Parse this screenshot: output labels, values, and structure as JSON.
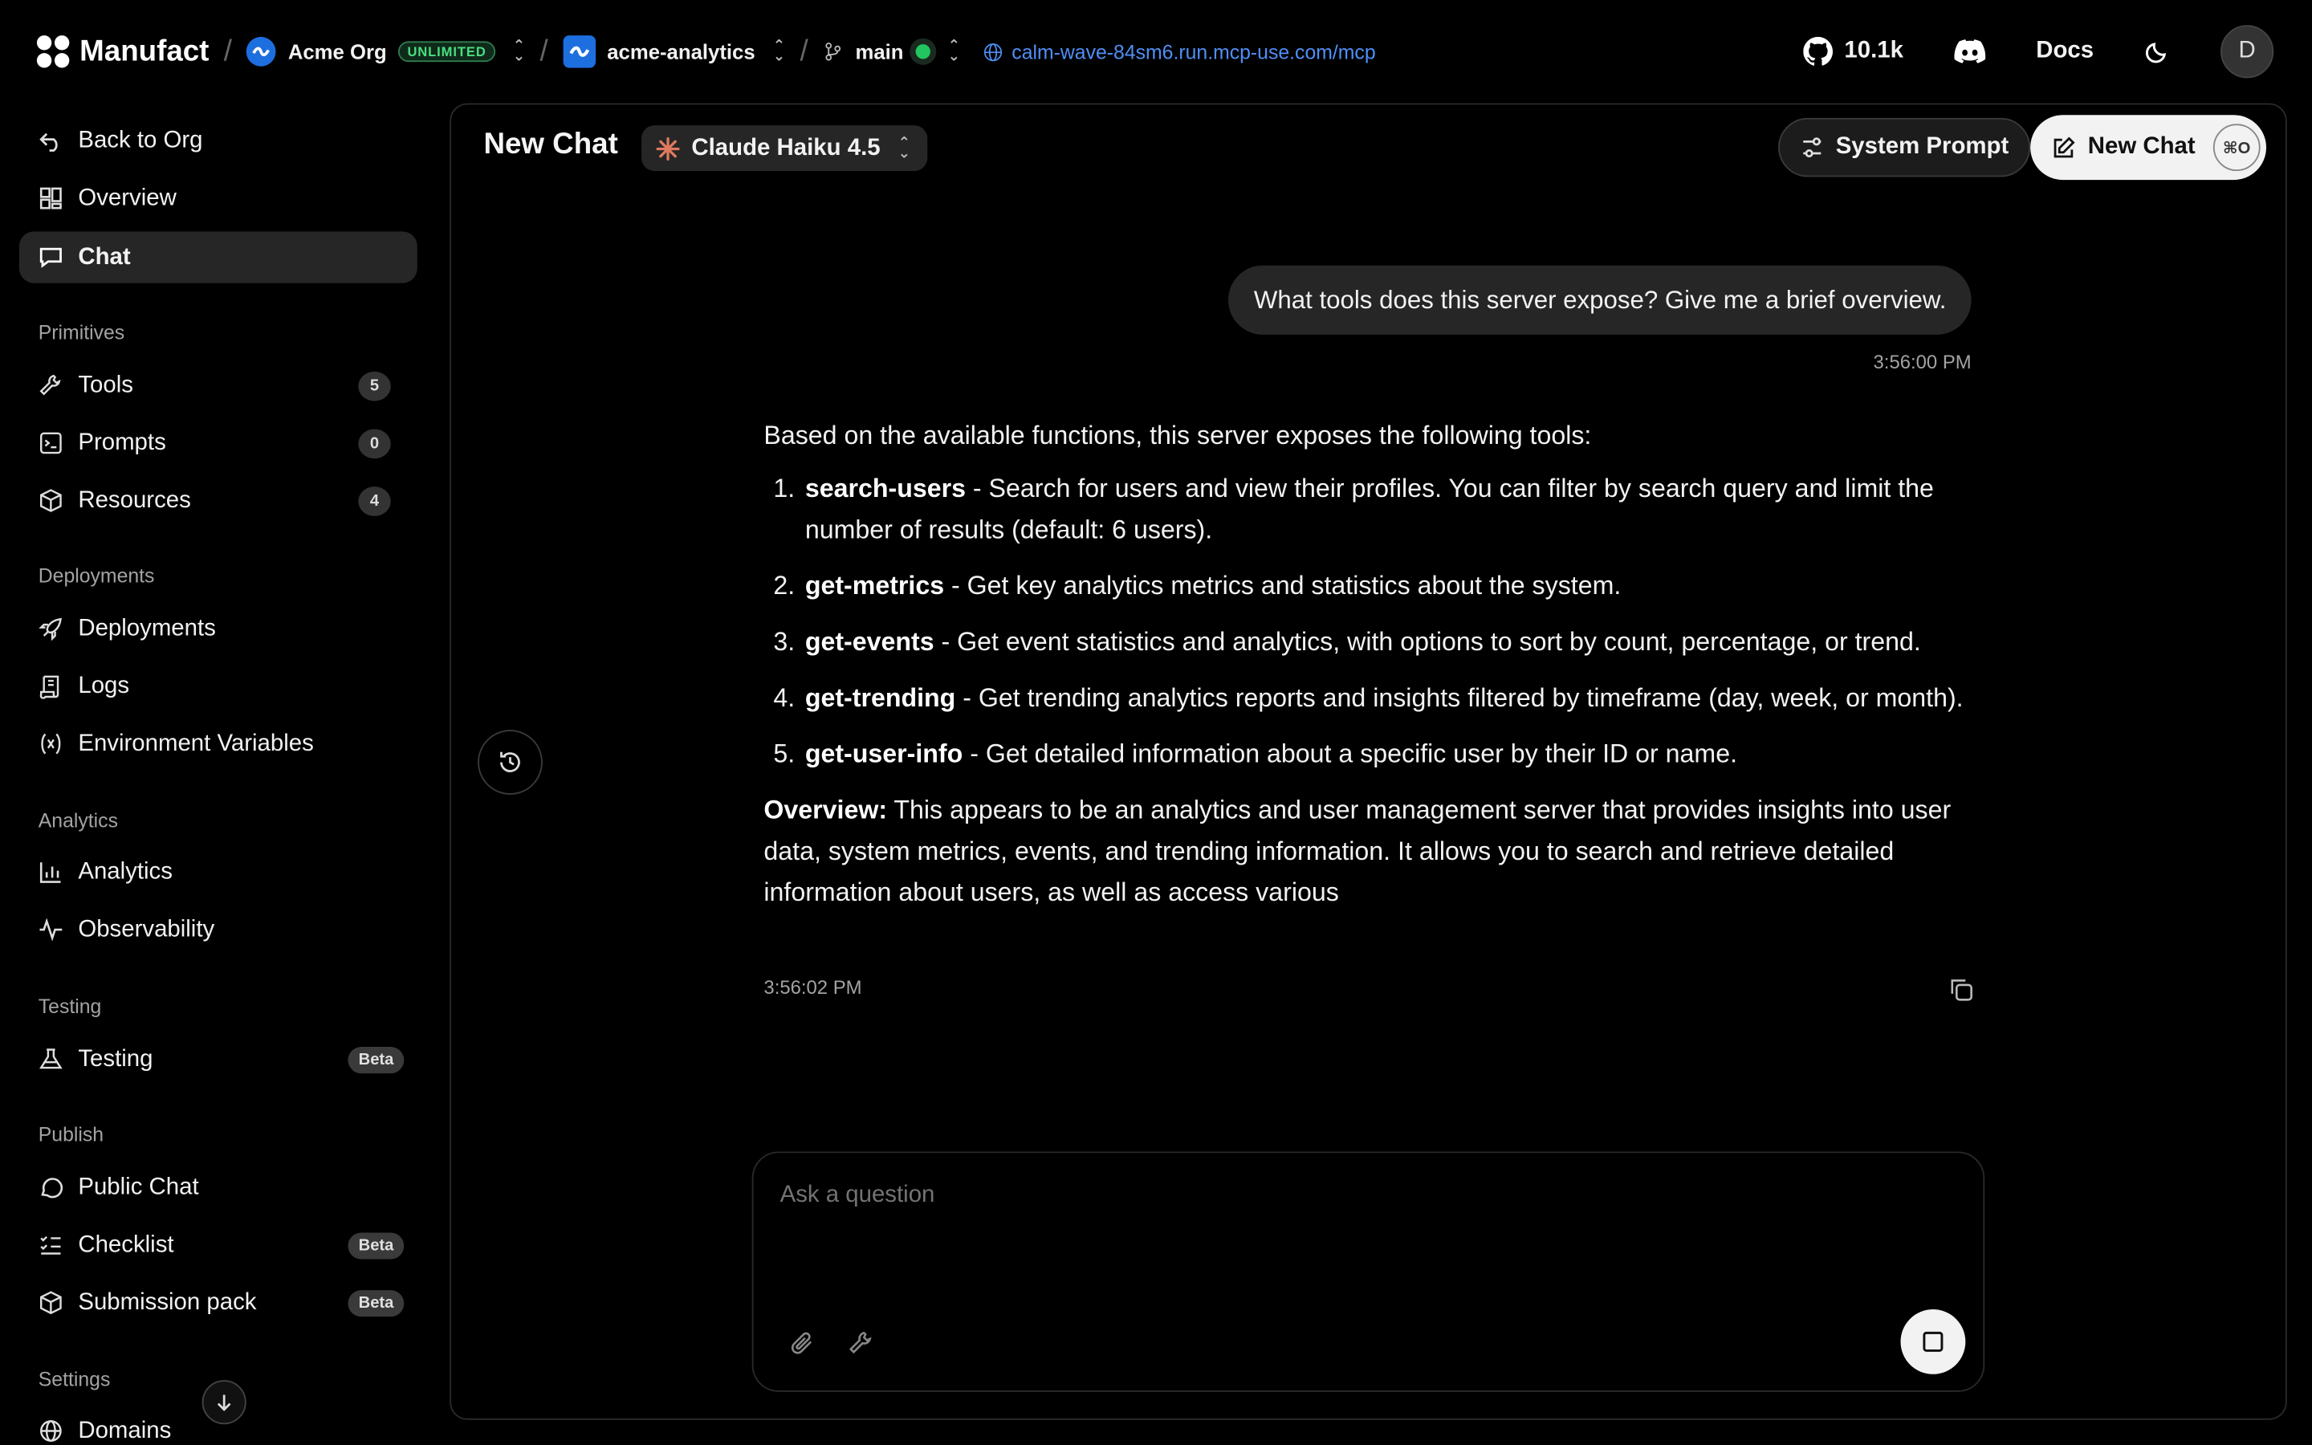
{
  "topbar": {
    "brand": "Manufact",
    "org_name": "Acme Org",
    "org_plan": "UNLIMITED",
    "project": "acme-analytics",
    "branch": "main",
    "url": "calm-wave-84sm6.run.mcp-use.com/mcp",
    "github_stars": "10.1k",
    "docs_label": "Docs",
    "avatar_initial": "D"
  },
  "sidebar": {
    "back": "Back to Org",
    "overview": "Overview",
    "chat": "Chat",
    "sections": {
      "primitives": "Primitives",
      "deployments": "Deployments",
      "analytics": "Analytics",
      "testing": "Testing",
      "publish": "Publish",
      "settings": "Settings"
    },
    "items": {
      "tools": "Tools",
      "tools_count": "5",
      "prompts": "Prompts",
      "prompts_count": "0",
      "resources": "Resources",
      "resources_count": "4",
      "deployments": "Deployments",
      "logs": "Logs",
      "env": "Environment Variables",
      "analytics": "Analytics",
      "observability": "Observability",
      "testing": "Testing",
      "testing_badge": "Beta",
      "public_chat": "Public Chat",
      "checklist": "Checklist",
      "checklist_badge": "Beta",
      "submission": "Submission pack",
      "submission_badge": "Beta",
      "domains": "Domains"
    }
  },
  "chat": {
    "title": "New Chat",
    "model": "Claude Haiku 4.5",
    "system_prompt_label": "System Prompt",
    "new_chat_label": "New Chat",
    "new_chat_shortcut": "⌘O",
    "user_message": "What tools does this server expose? Give me a brief overview.",
    "user_time": "3:56:00 PM",
    "answer_intro": "Based on the available functions, this server exposes the following tools:",
    "tools": [
      {
        "name": "search-users",
        "desc": " - Search for users and view their profiles. You can filter by search query and limit the number of results (default: 6 users)."
      },
      {
        "name": "get-metrics",
        "desc": " - Get key analytics metrics and statistics about the system."
      },
      {
        "name": "get-events",
        "desc": " - Get event statistics and analytics, with options to sort by count, percentage, or trend."
      },
      {
        "name": "get-trending",
        "desc": " - Get trending analytics reports and insights filtered by timeframe (day, week, or month)."
      },
      {
        "name": "get-user-info",
        "desc": " - Get detailed information about a specific user by their ID or name."
      }
    ],
    "overview_label": "Overview:",
    "overview_text": " This appears to be an analytics and user management server that provides insights into user data, system metrics, events, and trending information. It allows you to search and retrieve detailed information about users, as well as access various",
    "answer_time": "3:56:02 PM",
    "composer_placeholder": "Ask a question"
  }
}
